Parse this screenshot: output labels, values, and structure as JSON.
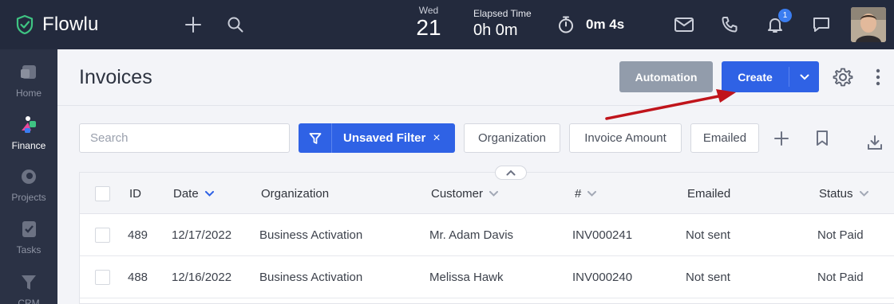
{
  "app": {
    "name": "Flowlu"
  },
  "topbar": {
    "date_dow": "Wed",
    "date_day": "21",
    "elapsed_label": "Elapsed Time",
    "elapsed_value": "0h 0m",
    "timer_value": "0m 4s",
    "notifications_count": "1"
  },
  "sidebar": {
    "items": [
      {
        "label": "Home",
        "icon": "home-icon"
      },
      {
        "label": "Finance",
        "icon": "finance-icon",
        "active": true
      },
      {
        "label": "Projects",
        "icon": "projects-icon"
      },
      {
        "label": "Tasks",
        "icon": "tasks-icon"
      },
      {
        "label": "CRM",
        "icon": "crm-icon"
      }
    ]
  },
  "header": {
    "title": "Invoices",
    "automation_label": "Automation",
    "create_label": "Create"
  },
  "filters": {
    "search_placeholder": "Search",
    "active_filter": "Unsaved Filter",
    "close_glyph": "×",
    "pills": [
      "Organization",
      "Invoice Amount",
      "Emailed"
    ]
  },
  "table": {
    "columns": [
      "ID",
      "Date",
      "Organization",
      "Customer",
      "#",
      "Emailed",
      "Status"
    ],
    "rows": [
      {
        "id": "489",
        "date": "12/17/2022",
        "organization": "Business Activation",
        "customer": "Mr. Adam Davis",
        "number": "INV000241",
        "emailed": "Not sent",
        "status": "Not Paid"
      },
      {
        "id": "488",
        "date": "12/16/2022",
        "organization": "Business Activation",
        "customer": "Melissa Hawk",
        "number": "INV000240",
        "emailed": "Not sent",
        "status": "Not Paid"
      }
    ]
  },
  "colors": {
    "topbar_bg": "#232a3d",
    "sidebar_bg": "#2b3245",
    "primary": "#2f62e5",
    "logo_green": "#3fc483",
    "annotation_arrow": "#c0141b"
  }
}
